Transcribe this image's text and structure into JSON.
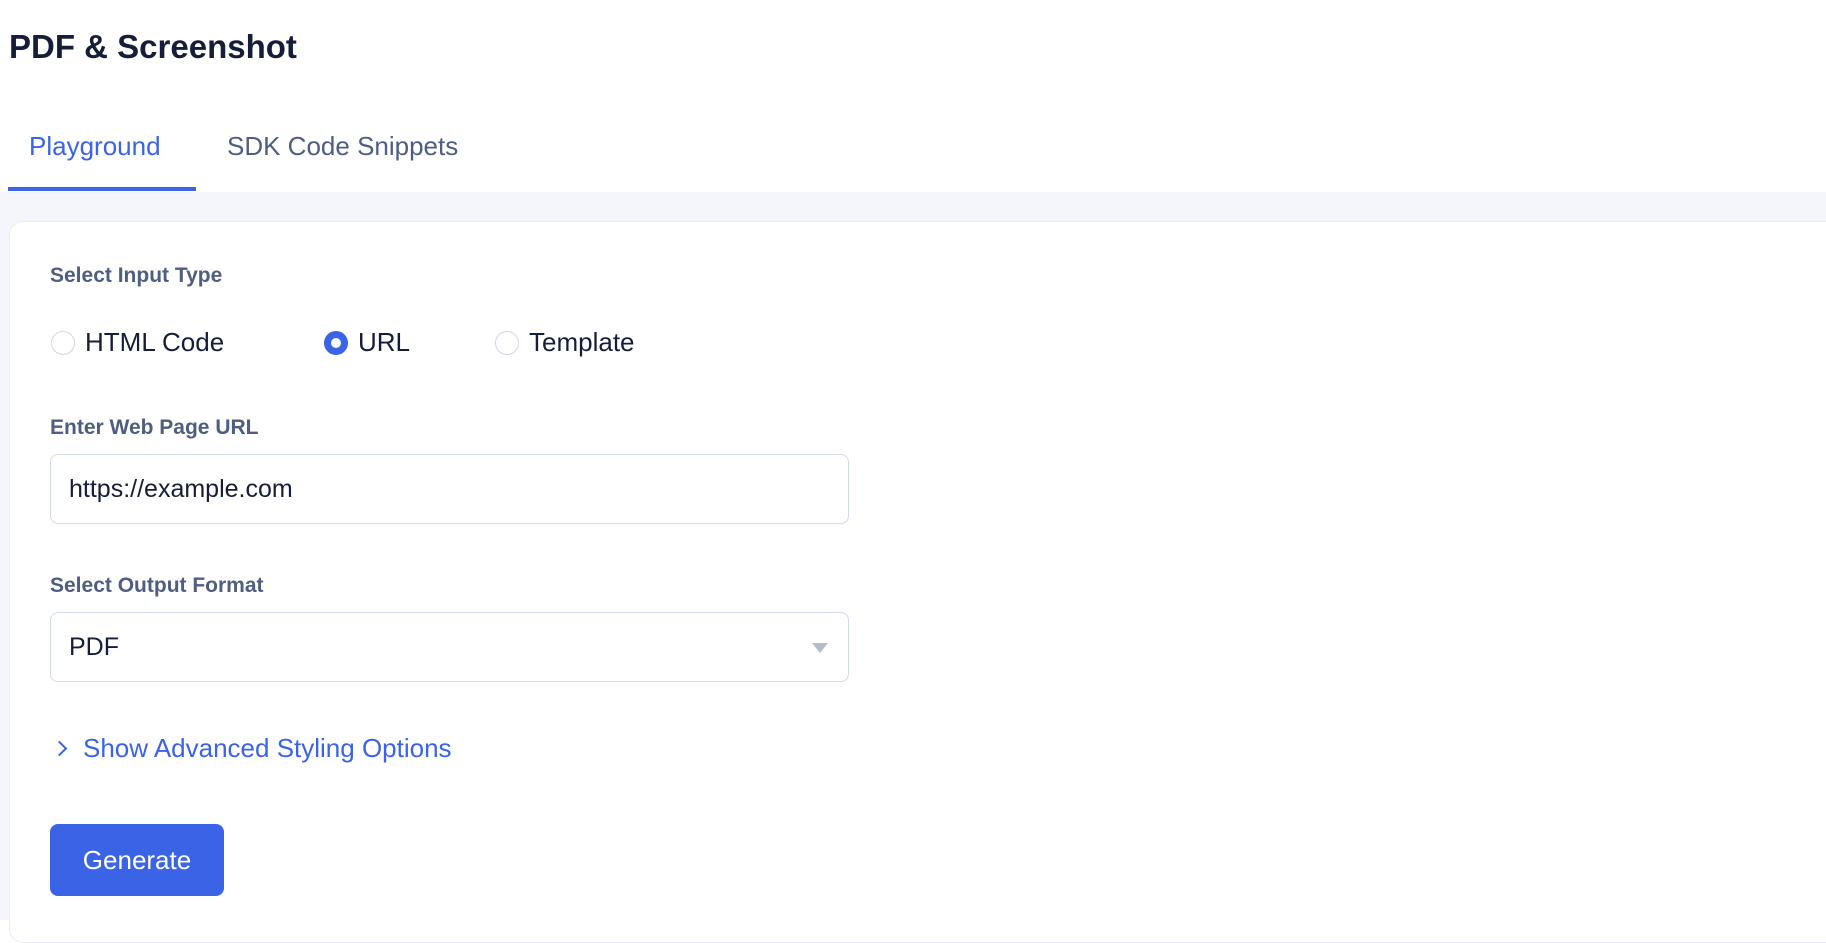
{
  "header": {
    "title": "PDF & Screenshot"
  },
  "tabs": [
    {
      "label": "Playground",
      "active": true
    },
    {
      "label": "SDK Code Snippets",
      "active": false
    }
  ],
  "form": {
    "input_type_label": "Select Input Type",
    "input_types": [
      {
        "label": "HTML Code",
        "selected": false
      },
      {
        "label": "URL",
        "selected": true
      },
      {
        "label": "Template",
        "selected": false
      }
    ],
    "url_label": "Enter Web Page URL",
    "url_value": "https://example.com",
    "output_label": "Select Output Format",
    "output_value": "PDF",
    "advanced_label": "Show Advanced Styling Options",
    "generate_label": "Generate"
  },
  "colors": {
    "accent": "#3a63e6",
    "label": "#4f5d80",
    "background": "#f4f6fb"
  },
  "icons": {
    "advanced": "chevron-right-icon",
    "select": "caret-down-icon"
  }
}
